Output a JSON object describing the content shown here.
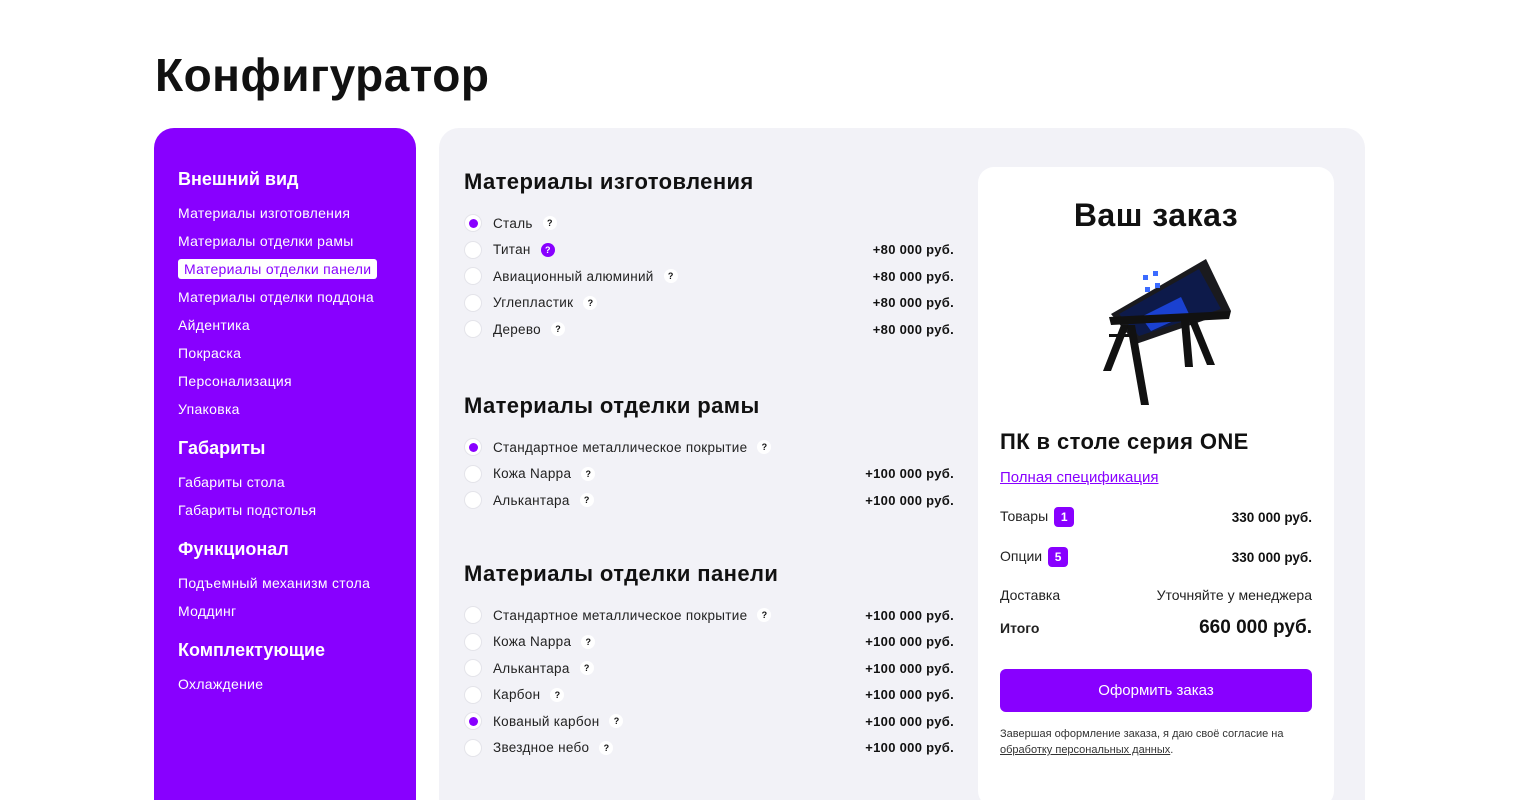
{
  "page": {
    "title": "Конфигуратор"
  },
  "colors": {
    "accent": "#8800ff",
    "panel_bg": "#f2f2f7"
  },
  "sidebar": {
    "groups": [
      {
        "heading": "Внешний вид",
        "items": [
          "Материалы изготовления",
          "Материалы отделки рамы",
          "Материалы отделки панели",
          "Материалы отделки поддона",
          "Айдентика",
          "Покраска",
          "Персонализация",
          "Упаковка"
        ]
      },
      {
        "heading": "Габариты",
        "items": [
          "Габариты стола",
          "Габариты подстолья"
        ]
      },
      {
        "heading": "Функционал",
        "items": [
          "Подъемный механизм стола",
          "Моддинг"
        ]
      },
      {
        "heading": "Комплектующие",
        "items": [
          "Охлаждение"
        ]
      }
    ],
    "active_item": "Материалы отделки панели"
  },
  "sections": [
    {
      "title": "Материалы изготовления",
      "options": [
        {
          "label": "Сталь",
          "price": "",
          "checked": true,
          "help_accent": false
        },
        {
          "label": "Титан",
          "price": "+80 000 руб.",
          "checked": false,
          "help_accent": true
        },
        {
          "label": "Авиационный алюминий",
          "price": "+80 000 руб.",
          "checked": false,
          "help_accent": false
        },
        {
          "label": "Углепластик",
          "price": "+80 000 руб.",
          "checked": false,
          "help_accent": false
        },
        {
          "label": "Дерево",
          "price": "+80 000 руб.",
          "checked": false,
          "help_accent": false
        }
      ]
    },
    {
      "title": "Материалы отделки рамы",
      "options": [
        {
          "label": "Стандартное металлическое покрытие",
          "price": "",
          "checked": true,
          "help_accent": false
        },
        {
          "label": "Кожа Nappa",
          "price": "+100 000 руб.",
          "checked": false,
          "help_accent": false
        },
        {
          "label": "Алькантара",
          "price": "+100 000 руб.",
          "checked": false,
          "help_accent": false
        }
      ]
    },
    {
      "title": "Материалы отделки панели",
      "options": [
        {
          "label": "Стандартное металлическое покрытие",
          "price": "+100 000 руб.",
          "checked": false,
          "help_accent": false
        },
        {
          "label": "Кожа Nappa",
          "price": "+100 000 руб.",
          "checked": false,
          "help_accent": false
        },
        {
          "label": "Алькантара",
          "price": "+100 000 руб.",
          "checked": false,
          "help_accent": false
        },
        {
          "label": "Карбон",
          "price": "+100 000 руб.",
          "checked": false,
          "help_accent": false
        },
        {
          "label": "Кованый карбон",
          "price": "+100 000 руб.",
          "checked": true,
          "help_accent": false
        },
        {
          "label": "Звездное небо",
          "price": "+100 000 руб.",
          "checked": false,
          "help_accent": false
        }
      ]
    }
  ],
  "help_glyph": "?",
  "order": {
    "title": "Ваш заказ",
    "product_name": "ПК в столе серия ONE",
    "spec_link": "Полная спецификация",
    "goods_label": "Товары",
    "goods_count": "1",
    "goods_value": "330 000 руб.",
    "options_label": "Опции",
    "options_count": "5",
    "options_value": "330 000 руб.",
    "delivery_label": "Доставка",
    "delivery_value": "Уточняйте у менеджера",
    "total_label": "Итого",
    "total_value": "660 000 руб.",
    "button": "Оформить заказ",
    "consent_text": "Завершая оформление заказа, я даю своё согласие на",
    "consent_link": "обработку персональных данных",
    "consent_end": "."
  }
}
